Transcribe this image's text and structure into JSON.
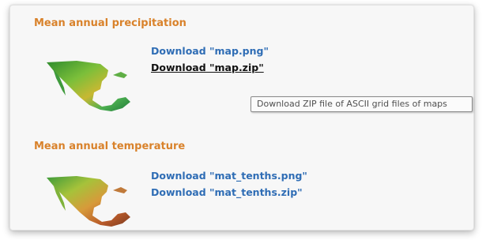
{
  "sections": [
    {
      "title": "Mean annual precipitation",
      "thumbnail_icon": "precipitation-map-thumbnail",
      "links": [
        "Download \"map.png\"",
        "Download \"map.zip\""
      ]
    },
    {
      "title": "Mean annual temperature",
      "thumbnail_icon": "temperature-map-thumbnail",
      "links": [
        "Download \"mat_tenths.png\"",
        "Download \"mat_tenths.zip\""
      ]
    }
  ],
  "tooltip": "Download ZIP file of ASCII grid files of maps",
  "colors": {
    "section_title": "#d9822b",
    "link": "#2f6db5",
    "link_hover": "#111111",
    "panel_background": "#f7f7f7"
  }
}
